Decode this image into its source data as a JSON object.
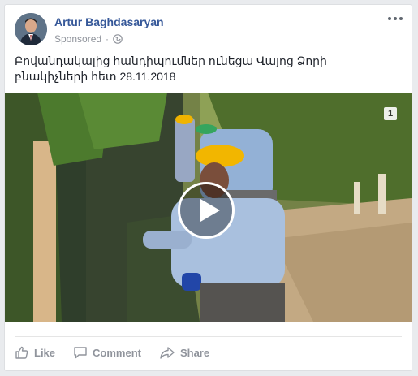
{
  "post": {
    "author": "Artur Baghdasaryan",
    "sponsored_label": "Sponsored",
    "separator": "·",
    "text": "Բովանդակալից հանդիպումներ ունեցա Վայոց Ձորի բնակիչների հետ 28.11.2018",
    "video_badge": "1"
  },
  "actions": {
    "like": "Like",
    "comment": "Comment",
    "share": "Share"
  },
  "icons": {
    "audience": "globe-icon",
    "menu": "more-options-icon",
    "like": "thumbs-up-icon",
    "comment": "comment-bubble-icon",
    "share": "share-arrow-icon",
    "play": "play-icon"
  },
  "colors": {
    "author_link": "#365899",
    "meta_text": "#90949c",
    "body_text": "#1d2129"
  }
}
